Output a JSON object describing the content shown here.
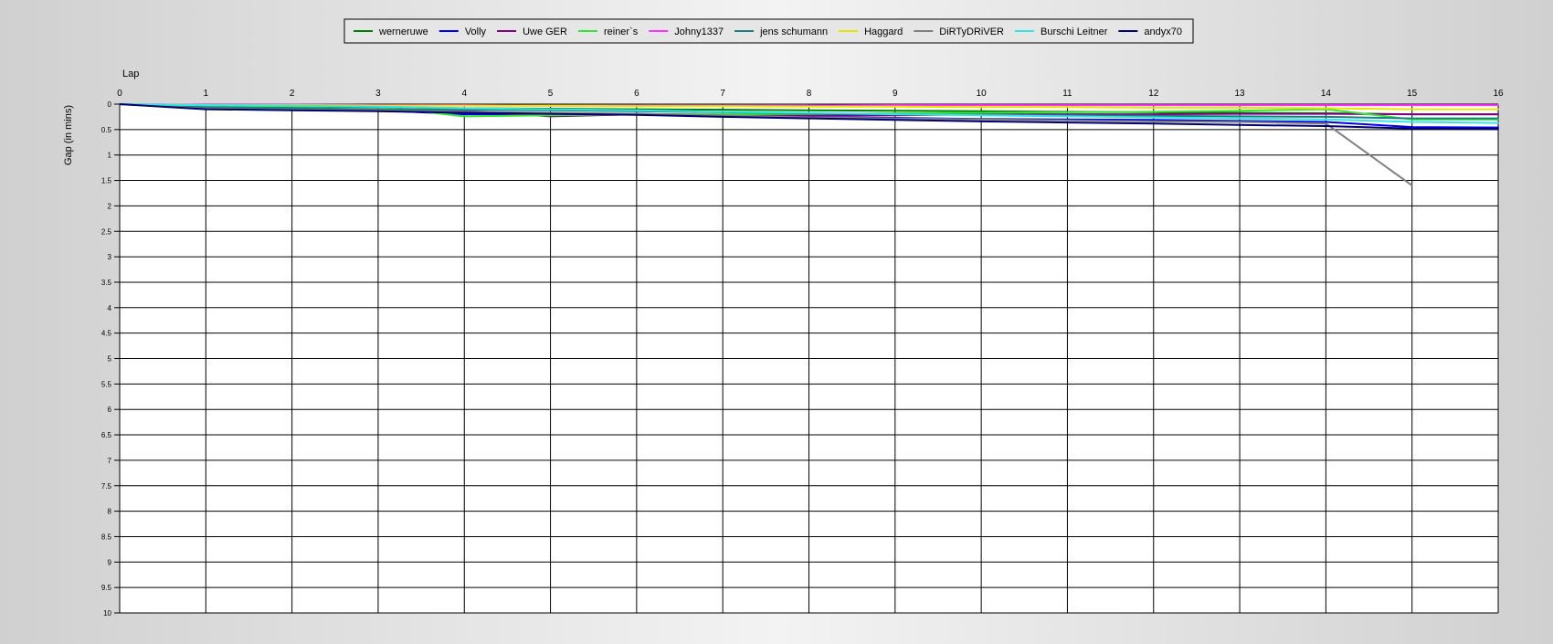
{
  "chart_data": {
    "type": "line",
    "title": "",
    "xlabel": "Lap",
    "ylabel": "Gap (in mins)",
    "x_ticks": [
      0,
      1,
      2,
      3,
      4,
      5,
      6,
      7,
      8,
      9,
      10,
      11,
      12,
      13,
      14,
      15,
      16
    ],
    "y_ticks": [
      0,
      0.5,
      1,
      1.5,
      2,
      2.5,
      3,
      3.5,
      4,
      4.5,
      5,
      5.5,
      6,
      6.5,
      7,
      7.5,
      8,
      8.5,
      9,
      9.5,
      10
    ],
    "xlim": [
      0,
      16
    ],
    "ylim": [
      0,
      10
    ],
    "y_inverted": true,
    "grid": true,
    "legend_position": "top-center",
    "x": [
      0,
      1,
      2,
      3,
      4,
      5,
      6,
      7,
      8,
      9,
      10,
      11,
      12,
      13,
      14,
      15,
      16
    ],
    "series": [
      {
        "name": "werneruwe",
        "color": "#008000",
        "values": [
          0,
          0.04,
          0.05,
          0.06,
          0.08,
          0.09,
          0.1,
          0.11,
          0.12,
          0.13,
          0.14,
          0.15,
          0.16,
          0.17,
          0.18,
          0.2,
          0.2
        ]
      },
      {
        "name": "Volly",
        "color": "#0000e6",
        "values": [
          0,
          0.08,
          0.1,
          0.12,
          0.2,
          0.2,
          0.19,
          0.22,
          0.25,
          0.27,
          0.29,
          0.3,
          0.31,
          0.33,
          0.35,
          0.45,
          0.46
        ]
      },
      {
        "name": "Uwe GER",
        "color": "#800080",
        "values": [
          0,
          0.07,
          0.09,
          0.11,
          0.13,
          0.24,
          0.2,
          0.21,
          0.22,
          0.22,
          0.2,
          0.2,
          0.2,
          0.19,
          0.19,
          0.2,
          0.2
        ]
      },
      {
        "name": "reiner`s",
        "color": "#33e633",
        "values": [
          0,
          0.03,
          0.04,
          0.05,
          0.24,
          0.22,
          0.2,
          0.2,
          0.19,
          0.18,
          0.17,
          0.16,
          0.15,
          0.13,
          0.1,
          0.3,
          0.3
        ]
      },
      {
        "name": "Johny1337",
        "color": "#ff33ff",
        "values": [
          0,
          0.01,
          0.01,
          0.02,
          0.02,
          0.03,
          0.03,
          0.03,
          0.03,
          0.02,
          0.02,
          0.02,
          0.02,
          0.02,
          0.02,
          0.02,
          0.02
        ]
      },
      {
        "name": "jens schumann",
        "color": "#1a8080",
        "values": [
          0,
          0.06,
          0.08,
          0.1,
          0.11,
          0.12,
          0.14,
          0.16,
          0.18,
          0.2,
          0.21,
          0.22,
          0.23,
          0.24,
          0.25,
          0.28,
          0.28
        ]
      },
      {
        "name": "Haggard",
        "color": "#e6e600",
        "values": [
          0,
          0.02,
          0.02,
          0.03,
          0.03,
          0.03,
          0.04,
          0.04,
          0.05,
          0.05,
          0.06,
          0.06,
          0.07,
          0.07,
          0.08,
          0.1,
          0.1
        ]
      },
      {
        "name": "DiRTyDRiVER",
        "color": "#7f7f7f",
        "values": [
          0,
          0.09,
          0.11,
          0.12,
          0.15,
          0.17,
          0.19,
          0.22,
          0.26,
          0.28,
          0.3,
          0.32,
          0.34,
          0.35,
          0.38,
          1.6,
          null
        ]
      },
      {
        "name": "Burschi Leitner",
        "color": "#33e6e6",
        "values": [
          0,
          0.02,
          0.03,
          0.05,
          0.08,
          0.1,
          0.12,
          0.15,
          0.17,
          0.2,
          0.22,
          0.24,
          0.26,
          0.28,
          0.3,
          0.35,
          0.37
        ]
      },
      {
        "name": "andyx70",
        "color": "#00006e",
        "values": [
          0,
          0.1,
          0.12,
          0.14,
          0.17,
          0.19,
          0.21,
          0.25,
          0.28,
          0.31,
          0.34,
          0.36,
          0.38,
          0.41,
          0.43,
          0.48,
          0.49
        ]
      }
    ]
  }
}
